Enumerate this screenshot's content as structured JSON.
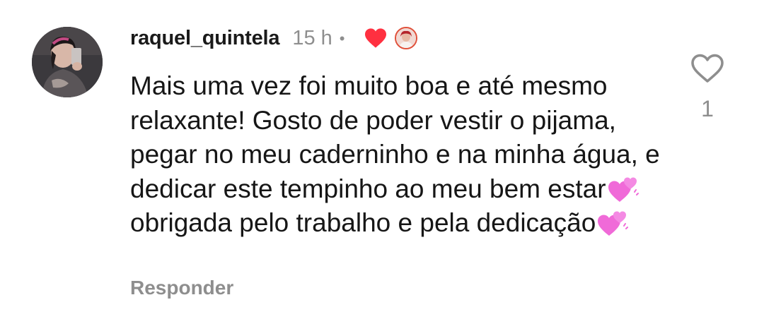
{
  "comment": {
    "username": "raquel_quintela",
    "time": "15 h",
    "separator": "•",
    "liked_by_creator_icon": "heart-filled-icon",
    "text_part1": "Mais uma vez foi muito boa e até mesmo relaxante! Gosto de poder vestir o pijama, pegar no meu caderninho e na minha água, e dedicar este tempinho ao meu bem estar",
    "text_part2": " obrigada pelo trabalho e pela dedicação",
    "emoji": "two-hearts-emoji",
    "reply_label": "Responder",
    "like_icon": "heart-outline-icon",
    "like_count": "1"
  },
  "colors": {
    "heart_red": "#ff3040",
    "secondary_text": "#8e8e8e",
    "emoji_pink": "#f06ad8"
  }
}
